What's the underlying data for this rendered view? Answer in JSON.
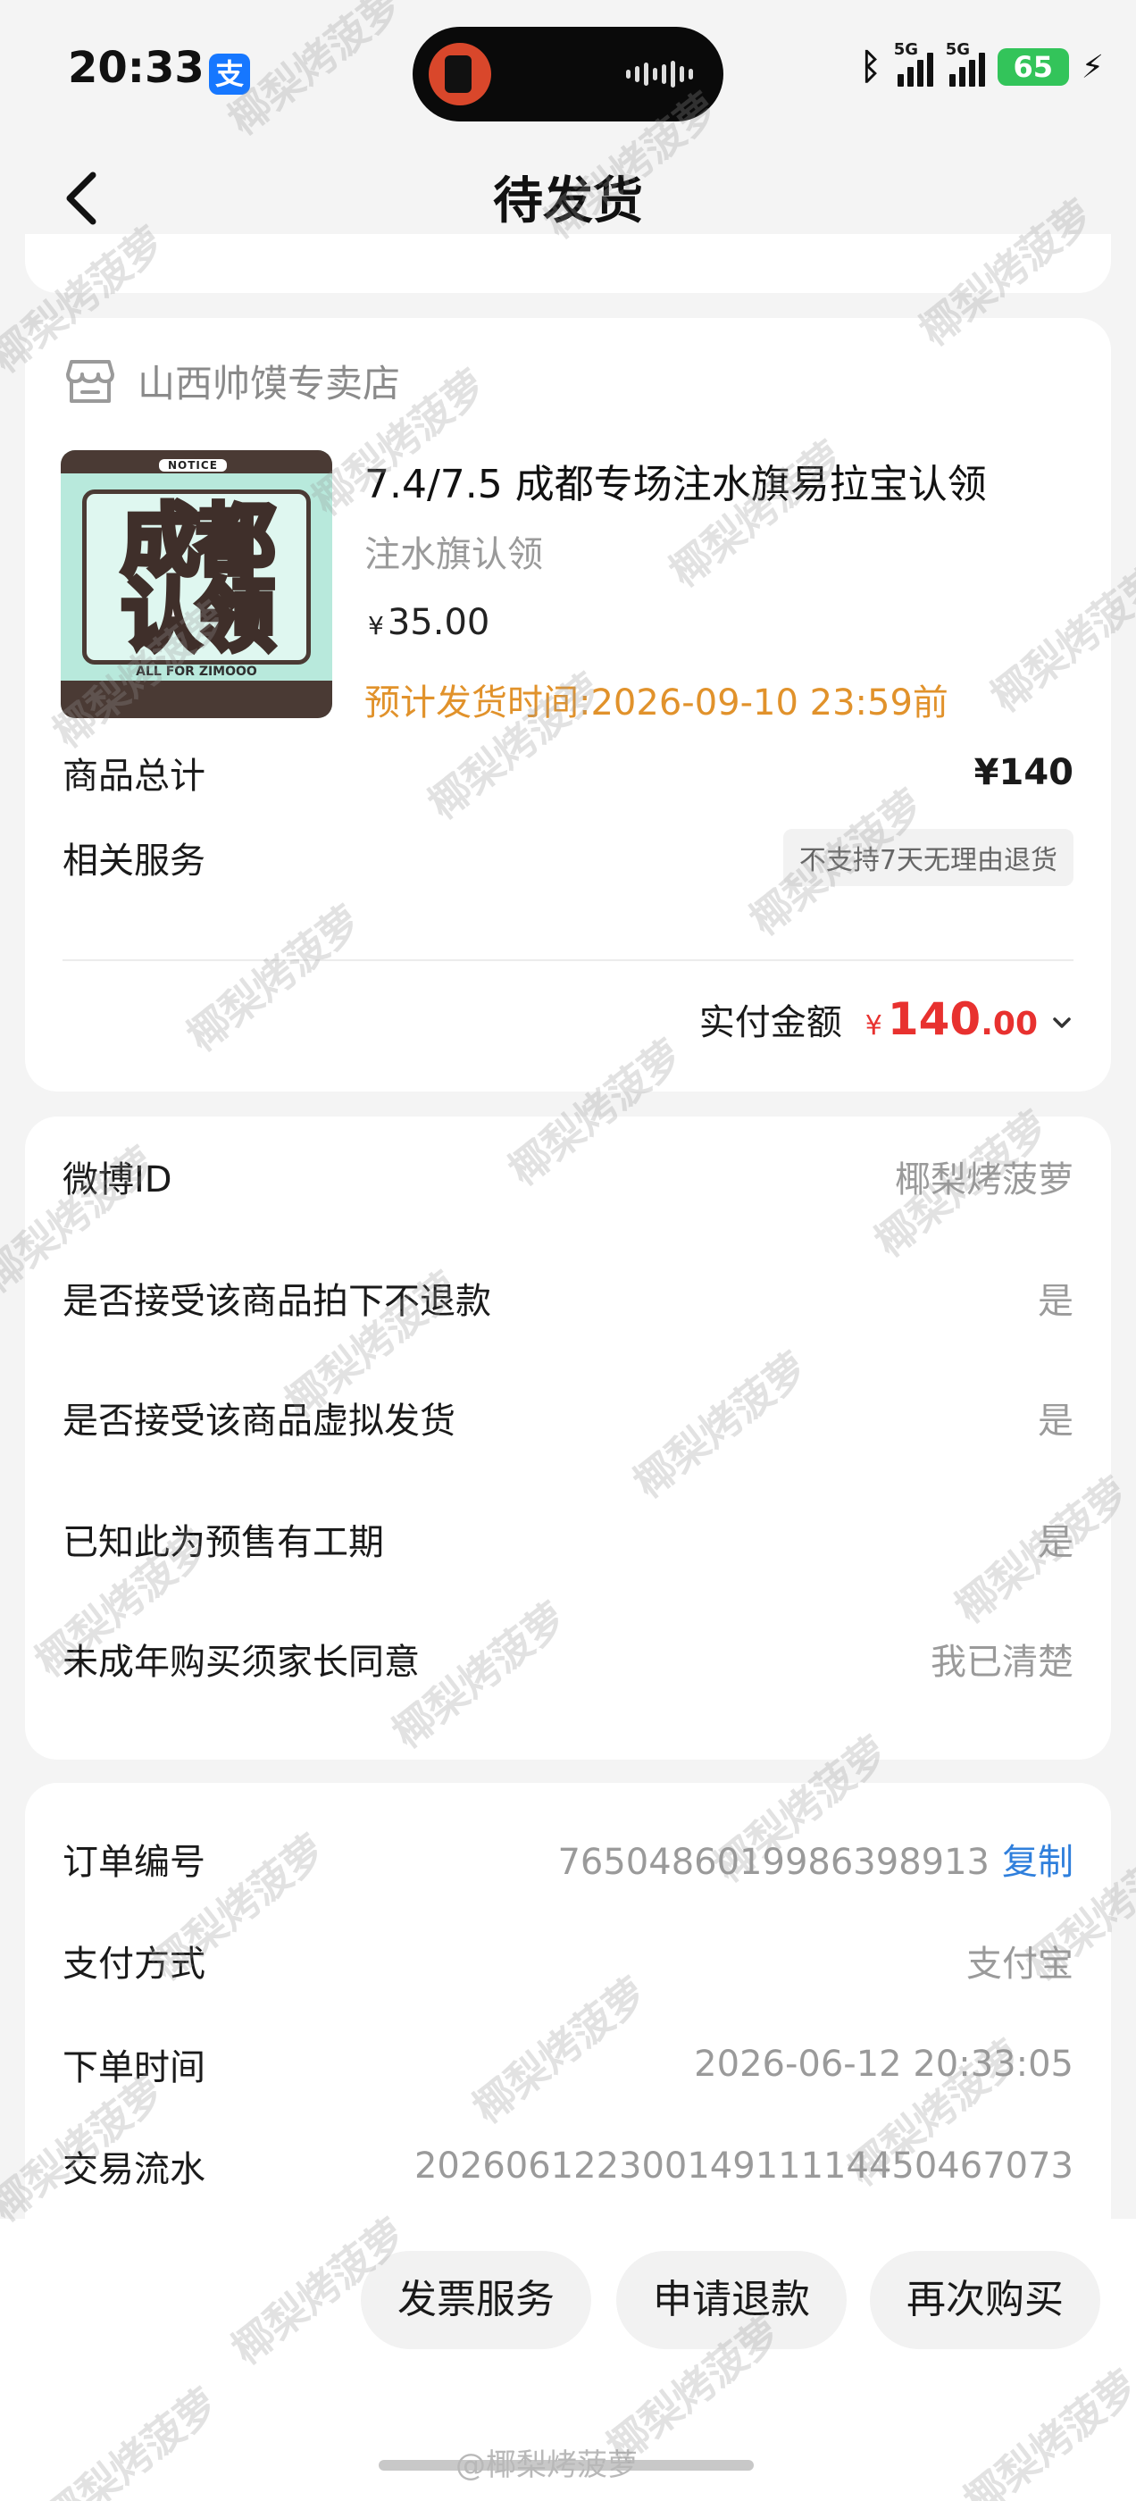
{
  "status_bar": {
    "time": "20:33",
    "alipay_glyph": "支",
    "network_1": "5G",
    "network_2": "5G",
    "battery": "65",
    "icons": [
      "alipay-icon",
      "bluetooth-icon",
      "signal-icon",
      "battery-icon",
      "charging-icon"
    ]
  },
  "nav": {
    "title": "待发货",
    "back_icon": "chevron-left-icon"
  },
  "shop": {
    "name": "山西帅馍专卖店",
    "icon": "store-icon"
  },
  "product": {
    "title": "7.4/7.5 成都专场注水旗易拉宝认领",
    "variant": "注水旗认领",
    "price_currency": "¥",
    "price": "35.00",
    "ship_estimate": "预计发货时间:2026-09-10 23:59前",
    "thumbnail": {
      "notice": "NOTICE",
      "line1": "成都",
      "line2": "认领",
      "footer": "ALL FOR ZIMOOO"
    }
  },
  "summary": {
    "total_label": "商品总计",
    "total_value": "¥140",
    "service_label": "相关服务",
    "service_tag": "不支持7天无理由退货",
    "paid_label": "实付金额",
    "paid_currency": "¥",
    "paid_int": "140",
    "paid_dec": ".00",
    "paid_chevron": "chevron-down-icon"
  },
  "form_info": [
    {
      "label": "微博ID",
      "value": "椰梨烤菠萝"
    },
    {
      "label": "是否接受该商品拍下不退款",
      "value": "是"
    },
    {
      "label": "是否接受该商品虚拟发货",
      "value": "是"
    },
    {
      "label": "已知此为预售有工期",
      "value": "是"
    },
    {
      "label": "未成年购买须家长同意",
      "value": "我已清楚"
    }
  ],
  "order_info": {
    "order_no_label": "订单编号",
    "order_no": "7650486019986398913",
    "copy_label": "复制",
    "pay_method_label": "支付方式",
    "pay_method": "支付宝",
    "order_time_label": "下单时间",
    "order_time": "2026-06-12 20:33:05",
    "txn_label": "交易流水",
    "txn_no": "20260612230014911114450467073"
  },
  "actions": {
    "invoice": "发票服务",
    "refund": "申请退款",
    "rebuy": "再次购买"
  },
  "watermark": "椰梨烤菠萝",
  "credit": "@椰梨烤菠萝"
}
